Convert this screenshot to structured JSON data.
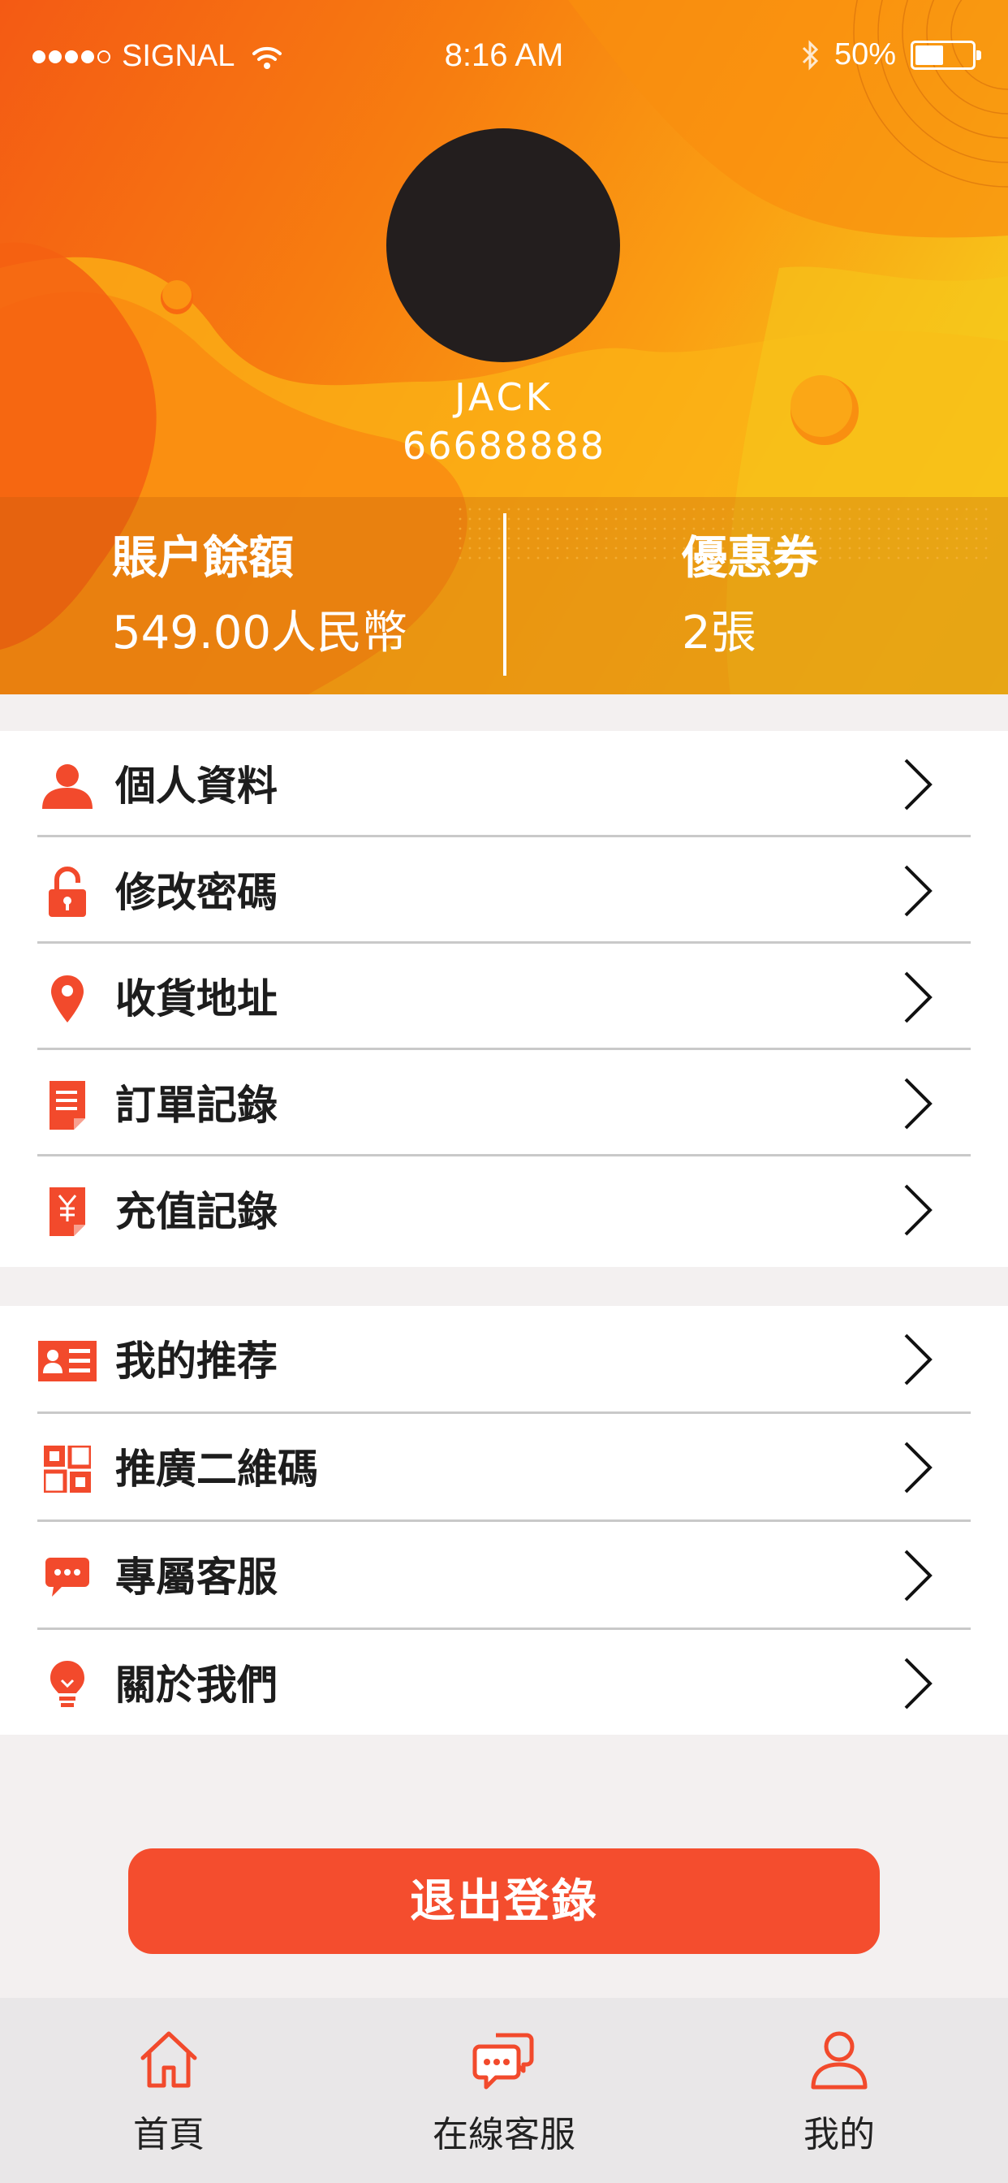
{
  "status_bar": {
    "carrier": "SIGNAL",
    "time": "8:16 AM",
    "battery": "50%",
    "battery_level": 0.5
  },
  "profile": {
    "name": "JACK",
    "id": "66688888"
  },
  "stats": {
    "balance_title": "賬户餘額",
    "balance_value": "549.00人民幣",
    "coupon_title": "優惠券",
    "coupon_value": "2張"
  },
  "menu_group_1": [
    {
      "label": "個人資料",
      "icon": "person-icon"
    },
    {
      "label": "修改密碼",
      "icon": "lock-icon"
    },
    {
      "label": "收貨地址",
      "icon": "location-pin-icon"
    },
    {
      "label": "訂單記錄",
      "icon": "order-document-icon"
    },
    {
      "label": "充值記錄",
      "icon": "recharge-document-icon"
    }
  ],
  "menu_group_2": [
    {
      "label": "我的推荐",
      "icon": "id-card-icon"
    },
    {
      "label": "推廣二維碼",
      "icon": "qr-code-icon"
    },
    {
      "label": "專屬客服",
      "icon": "chat-bubble-icon"
    },
    {
      "label": "關於我們",
      "icon": "lightbulb-icon"
    }
  ],
  "logout_label": "退出登錄",
  "tabs": [
    {
      "label": "首頁",
      "icon": "home-icon"
    },
    {
      "label": "在線客服",
      "icon": "chat-icon"
    },
    {
      "label": "我的",
      "icon": "user-icon"
    }
  ],
  "colors": {
    "accent": "#f44d2e",
    "icon": "#f24a2c",
    "header_start": "#f45a14",
    "header_end": "#f2df16"
  }
}
